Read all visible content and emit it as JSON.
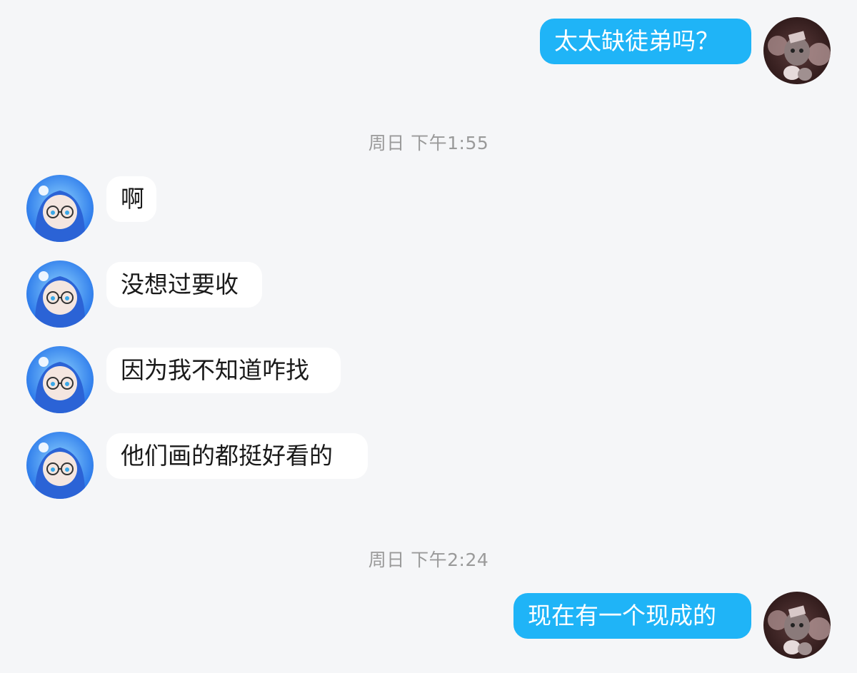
{
  "messages": [
    {
      "direction": "outgoing",
      "text": "太太缺徒弟吗？"
    },
    {
      "direction": "incoming",
      "text": "啊"
    },
    {
      "direction": "incoming",
      "text": "没想过要收"
    },
    {
      "direction": "incoming",
      "text": "因为我不知道咋找"
    },
    {
      "direction": "incoming",
      "text": "他们画的都挺好看的"
    },
    {
      "direction": "outgoing",
      "text": "现在有一个现成的"
    }
  ],
  "timestamps": [
    {
      "text": "周日  下午1:55"
    },
    {
      "text": "周日  下午2:24"
    }
  ],
  "colors": {
    "background": "#f5f6f8",
    "outgoing_bubble": "#1fb4f7",
    "incoming_bubble": "#ffffff",
    "timestamp_text": "#9a9a9a"
  },
  "icons": {
    "self_avatar": "avatar-dark-character",
    "other_avatar": "avatar-blue-hooded-character"
  }
}
